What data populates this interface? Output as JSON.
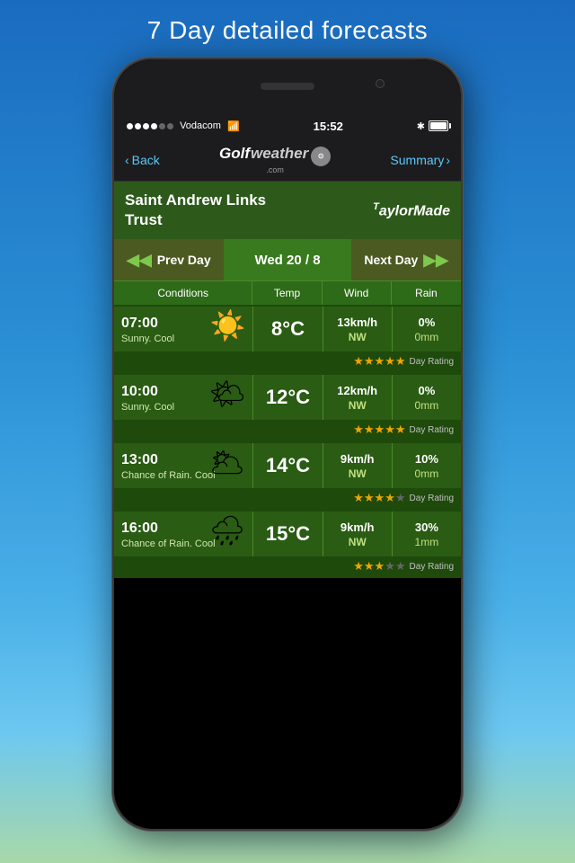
{
  "page": {
    "title": "7 Day detailed forecasts"
  },
  "status_bar": {
    "carrier": "Vodacom",
    "time": "15:52",
    "bluetooth": "✱",
    "signal_dots": [
      true,
      true,
      true,
      true,
      false,
      false
    ]
  },
  "nav": {
    "back_label": "Back",
    "logo_golf": "Golf",
    "logo_weather": "weather",
    "logo_domain": ".com",
    "summary_label": "Summary"
  },
  "course": {
    "name": "Saint Andrew Links\nTrust",
    "sponsor": "TaylorMade"
  },
  "day_nav": {
    "prev_label": "Prev Day",
    "date": "Wed 20 / 8",
    "next_label": "Next Day"
  },
  "table_headers": [
    "Conditions",
    "Temp",
    "Wind",
    "Rain"
  ],
  "rows": [
    {
      "time": "07:00",
      "condition": "Sunny. Cool",
      "icon": "☀️",
      "temp": "8°C",
      "wind_speed": "13km/h",
      "wind_dir": "NW",
      "rain_pct": "0%",
      "rain_mm": "0mm",
      "stars": 5,
      "rating_label": "Day Rating"
    },
    {
      "time": "10:00",
      "condition": "Sunny. Cool",
      "icon": "🌤",
      "temp": "12°C",
      "wind_speed": "12km/h",
      "wind_dir": "NW",
      "rain_pct": "0%",
      "rain_mm": "0mm",
      "stars": 5,
      "rating_label": "Day Rating"
    },
    {
      "time": "13:00",
      "condition": "Chance of Rain. Cool",
      "icon": "🌥",
      "temp": "14°C",
      "wind_speed": "9km/h",
      "wind_dir": "NW",
      "rain_pct": "10%",
      "rain_mm": "0mm",
      "stars": 4,
      "rating_label": "Day Rating"
    },
    {
      "time": "16:00",
      "condition": "Chance of Rain. Cool",
      "icon": "🌧",
      "temp": "15°C",
      "wind_speed": "9km/h",
      "wind_dir": "NW",
      "rain_pct": "30%",
      "rain_mm": "1mm",
      "stars": 3,
      "rating_label": "Day Rating"
    }
  ]
}
